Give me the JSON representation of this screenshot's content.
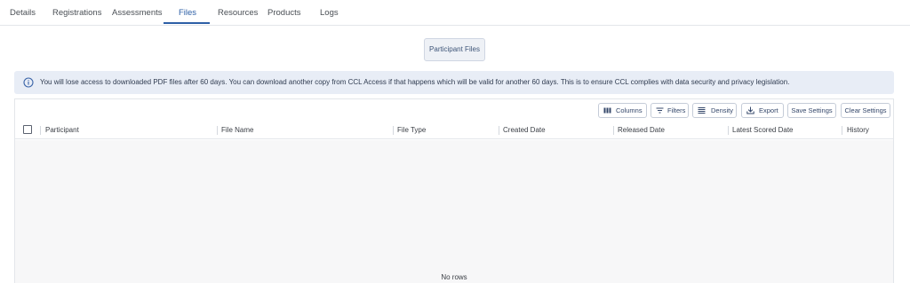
{
  "tabs": [
    {
      "label": "Details"
    },
    {
      "label": "Registrations"
    },
    {
      "label": "Assessments"
    },
    {
      "label": "Files",
      "active": true
    },
    {
      "label": "Resources"
    },
    {
      "label": "Products"
    },
    {
      "label": "Logs"
    }
  ],
  "participant_files_button": "Participant Files",
  "alert": {
    "icon": "info-icon",
    "text": "You will lose access to downloaded PDF files after 60 days. You can download another copy from CCL Access if that happens which will be valid for another 60 days. This is to ensure CCL complies with data security and privacy legislation."
  },
  "toolbar": {
    "columns": "Columns",
    "filters": "Filters",
    "density": "Density",
    "export": "Export",
    "save_settings": "Save Settings",
    "clear_settings": "Clear Settings"
  },
  "columns": [
    "Participant",
    "File Name",
    "File Type",
    "Created Date",
    "Released Date",
    "Latest Scored Date",
    "History"
  ],
  "empty_message": "No rows",
  "colors": {
    "accent": "#2d5fa6",
    "alert_bg": "#e8edf6"
  }
}
